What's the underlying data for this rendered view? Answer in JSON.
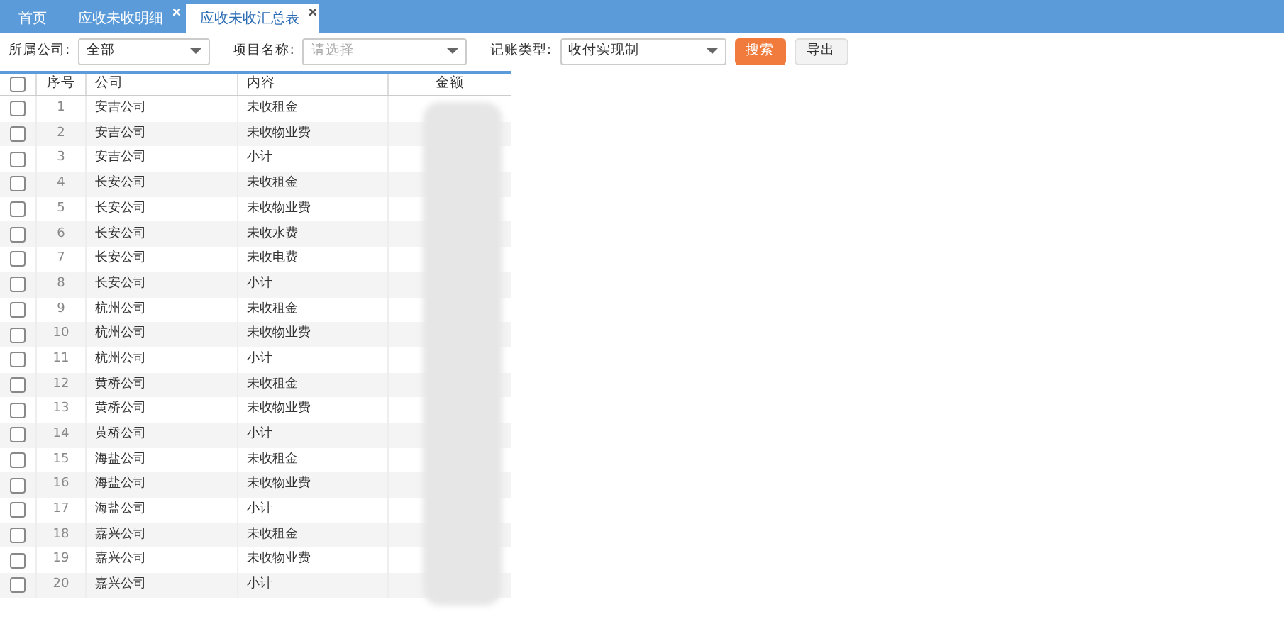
{
  "tabs": [
    {
      "label": "首页",
      "selected": false,
      "closable": false
    },
    {
      "label": "应收未收明细",
      "selected": false,
      "closable": true
    },
    {
      "label": "应收未收汇总表",
      "selected": true,
      "closable": true
    }
  ],
  "filters": [
    {
      "label": "所属公司:",
      "value": "全部"
    },
    {
      "label": "项目名称:",
      "placeholder": "请选择"
    },
    {
      "label": "记账类型:",
      "value": "收付实现制"
    }
  ],
  "buttons": [
    {
      "label": "搜索",
      "kind": "primary"
    },
    {
      "label": "导出",
      "kind": "plain"
    }
  ],
  "table": {
    "columns": [
      "序号",
      "公司",
      "内容",
      "金额"
    ],
    "header_checked": false,
    "rows": [
      {
        "no": "1",
        "company": "安吉公司",
        "content": "未收租金",
        "checked": false
      },
      {
        "no": "2",
        "company": "安吉公司",
        "content": "未收物业费",
        "checked": false
      },
      {
        "no": "3",
        "company": "安吉公司",
        "content": "小计",
        "checked": false
      },
      {
        "no": "4",
        "company": "长安公司",
        "content": "未收租金",
        "checked": false
      },
      {
        "no": "5",
        "company": "长安公司",
        "content": "未收物业费",
        "checked": false
      },
      {
        "no": "6",
        "company": "长安公司",
        "content": "未收水费",
        "checked": false
      },
      {
        "no": "7",
        "company": "长安公司",
        "content": "未收电费",
        "checked": false
      },
      {
        "no": "8",
        "company": "长安公司",
        "content": "小计",
        "checked": false
      },
      {
        "no": "9",
        "company": "杭州公司",
        "content": "未收租金",
        "checked": false
      },
      {
        "no": "10",
        "company": "杭州公司",
        "content": "未收物业费",
        "checked": false
      },
      {
        "no": "11",
        "company": "杭州公司",
        "content": "小计",
        "checked": false
      },
      {
        "no": "12",
        "company": "黄桥公司",
        "content": "未收租金",
        "checked": false
      },
      {
        "no": "13",
        "company": "黄桥公司",
        "content": "未收物业费",
        "checked": false
      },
      {
        "no": "14",
        "company": "黄桥公司",
        "content": "小计",
        "checked": false
      },
      {
        "no": "15",
        "company": "海盐公司",
        "content": "未收租金",
        "checked": false
      },
      {
        "no": "16",
        "company": "海盐公司",
        "content": "未收物业费",
        "checked": false
      },
      {
        "no": "17",
        "company": "海盐公司",
        "content": "小计",
        "checked": false
      },
      {
        "no": "18",
        "company": "嘉兴公司",
        "content": "未收租金",
        "checked": false
      },
      {
        "no": "19",
        "company": "嘉兴公司",
        "content": "未收物业费",
        "checked": false
      },
      {
        "no": "20",
        "company": "嘉兴公司",
        "content": "小计",
        "checked": false
      }
    ]
  }
}
